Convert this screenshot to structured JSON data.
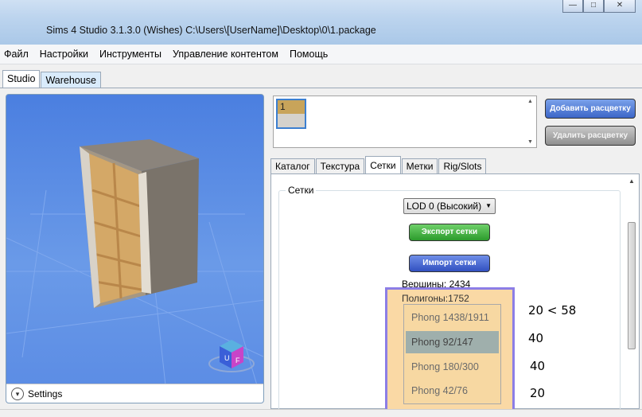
{
  "window": {
    "title": "Sims 4 Studio 3.1.3.0 (Wishes)  C:\\Users\\[UserName]\\Desktop\\0\\1.package",
    "controls": [
      "—",
      "□",
      "✕"
    ]
  },
  "menu": [
    "Файл",
    "Настройки",
    "Инструменты",
    "Управление контентом",
    "Помощь"
  ],
  "main_tabs": [
    "Studio",
    "Warehouse"
  ],
  "viewport": {
    "settings_label": "Settings",
    "gizmo_letters": [
      "U",
      "F"
    ]
  },
  "swatches": [
    {
      "number": "1"
    }
  ],
  "buttons": {
    "add_swatch": "Добавить расцветку",
    "remove_swatch": "Удалить расцветку",
    "export_mesh": "Экспорт сетки",
    "import_mesh": "Импорт сетки"
  },
  "sub_tabs": [
    "Каталог",
    "Текстура",
    "Сетки",
    "Метки",
    "Rig/Slots"
  ],
  "meshes": {
    "group_label": "Сетки",
    "lod_selected": "LOD 0 (Высокий)",
    "vertices": "Вершины:  2434",
    "polygons": "Полигоны:1752",
    "shaders": [
      "Phong 1438/1911",
      "Phong 92/147",
      "Phong 180/300",
      "Phong 42/76"
    ]
  },
  "annotations": [
    "20 < 58",
    "40",
    "40",
    "20"
  ],
  "colors": {
    "viewport_bg": "#5b8fe6",
    "annotation_fill": "#fad9a5",
    "annotation_border": "#8c7ee6",
    "selected_shader": "#9fafac",
    "add_button": "#3c66c8",
    "export_button": "#2c9b2c",
    "import_button": "#3150c0"
  }
}
